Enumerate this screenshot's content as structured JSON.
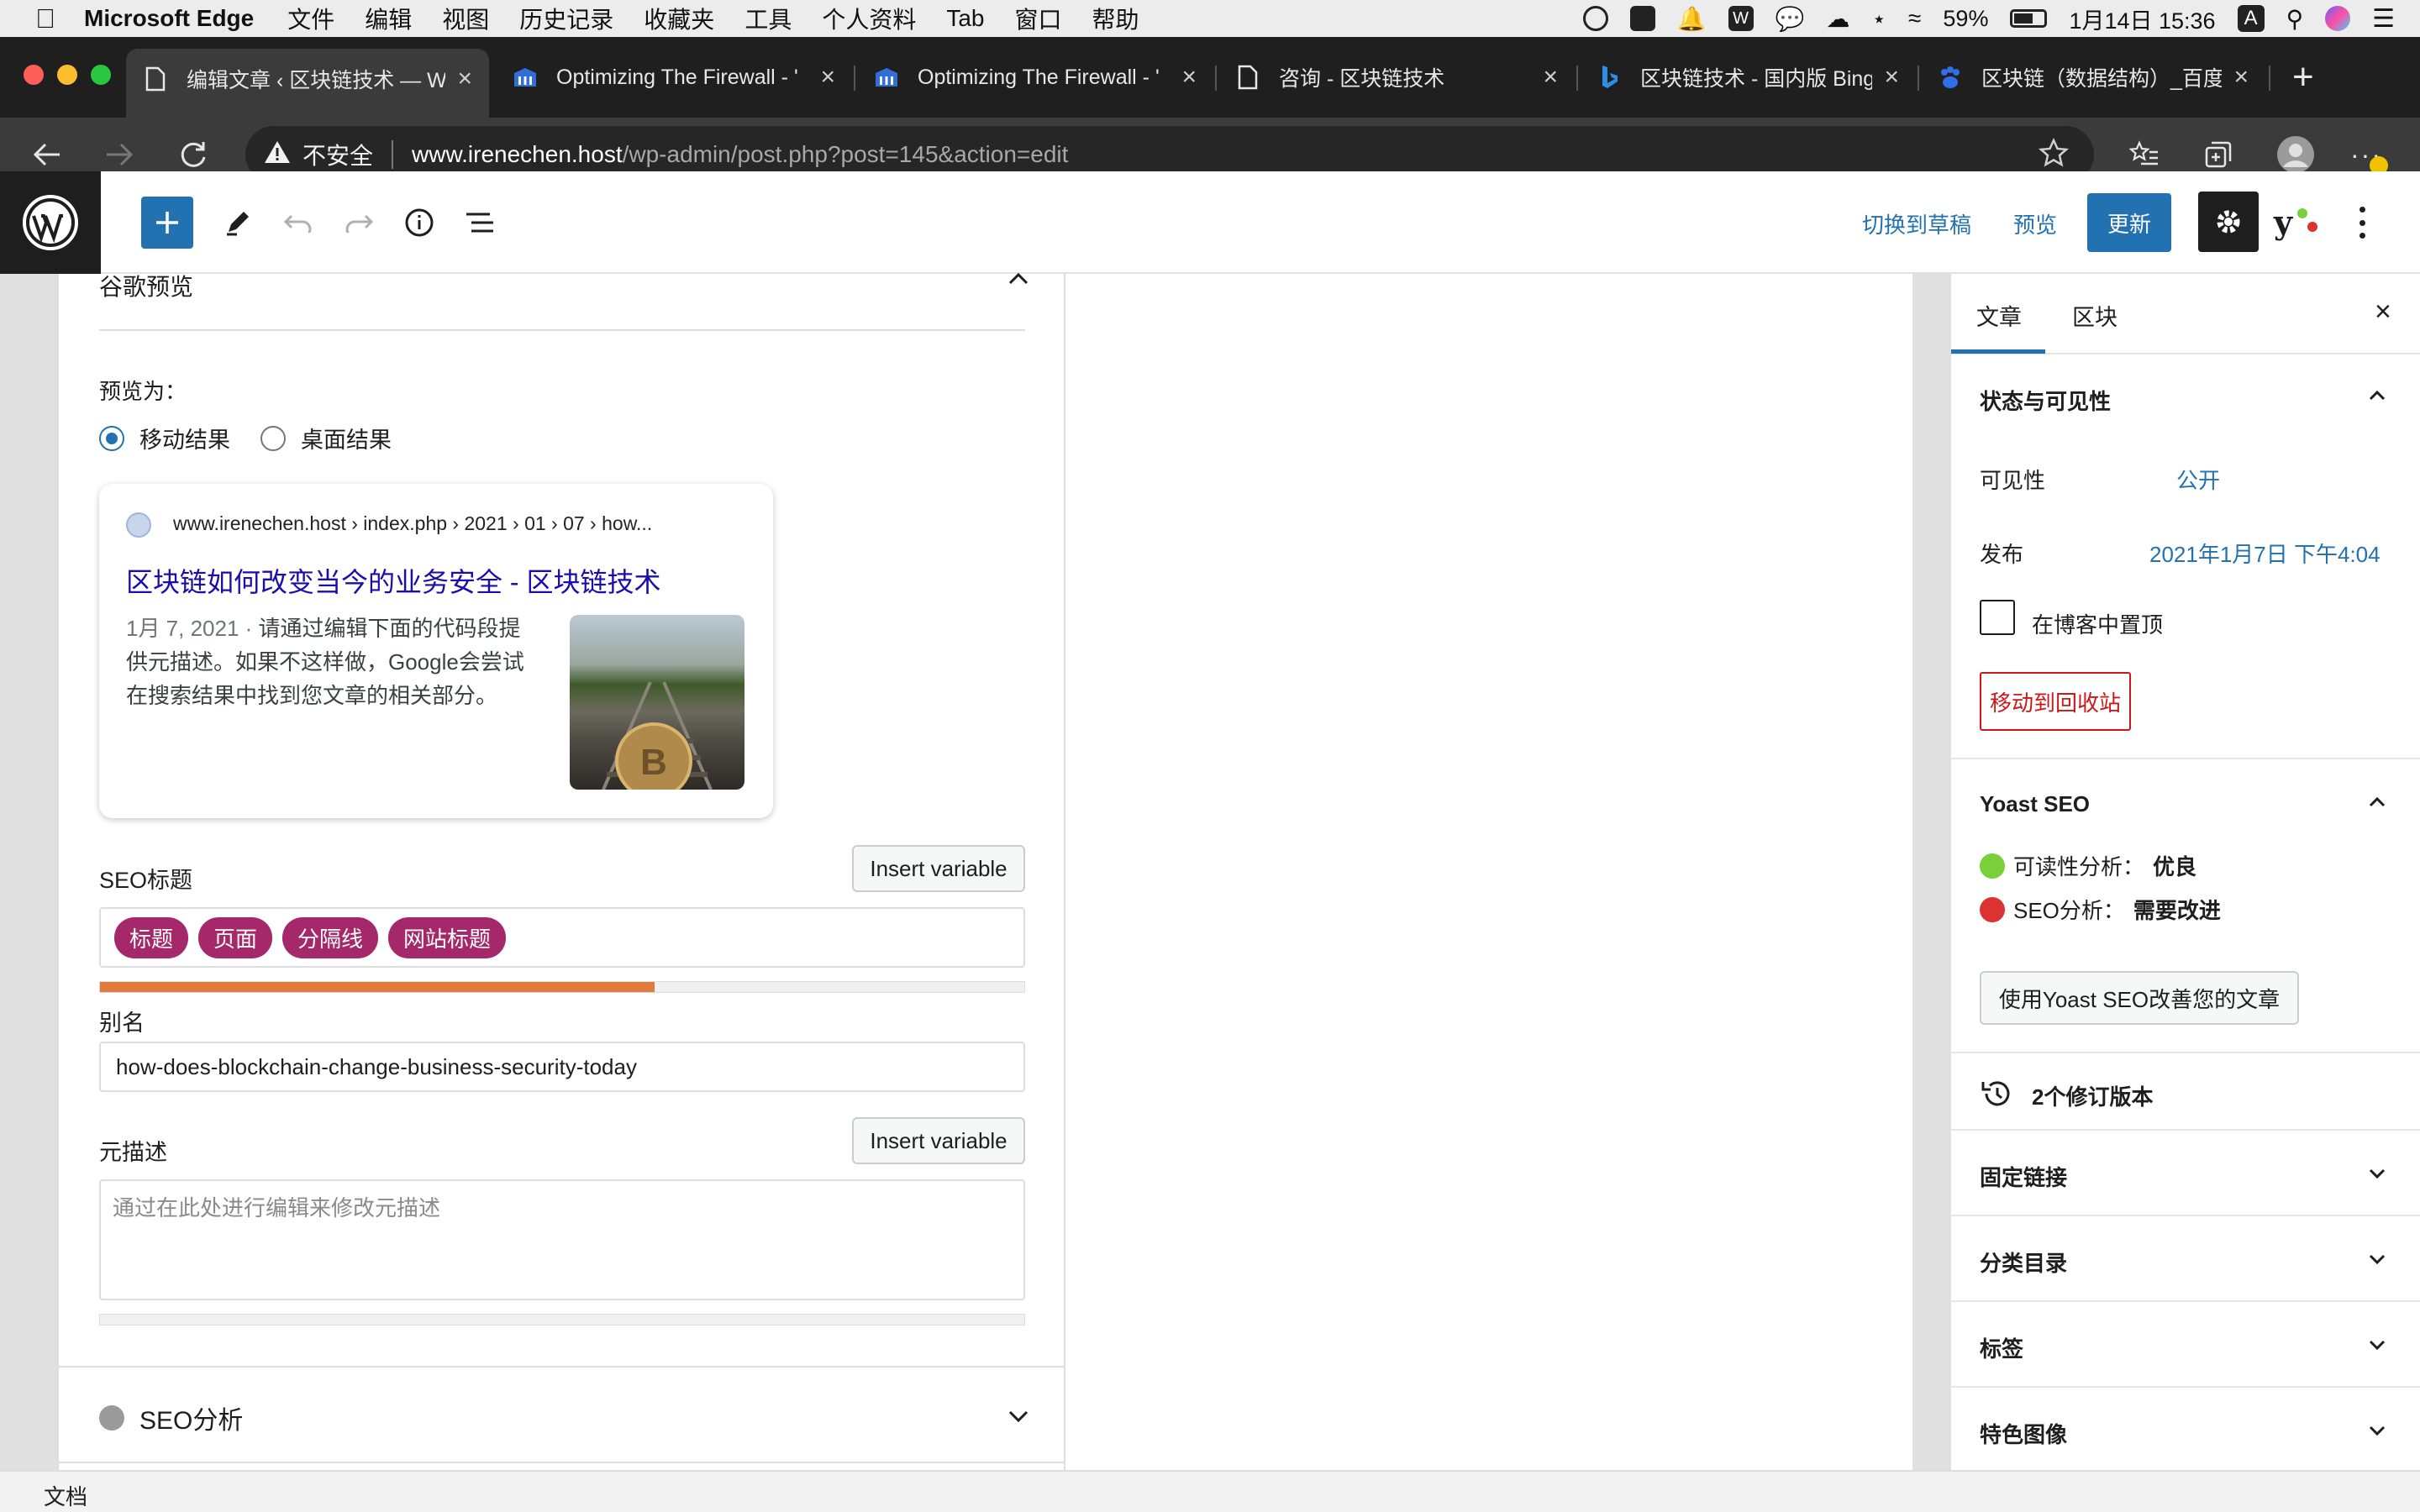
{
  "menubar": {
    "app": "Microsoft Edge",
    "items": [
      "文件",
      "编辑",
      "视图",
      "历史记录",
      "收藏夹",
      "工具",
      "个人资料",
      "Tab",
      "窗口",
      "帮助"
    ],
    "battery": "59%",
    "datetime": "1月14日 15:36",
    "input_method": "A"
  },
  "tabs": [
    {
      "label": "编辑文章 ‹ 区块链技术 — W",
      "active": true
    },
    {
      "label": "Optimizing The Firewall - '"
    },
    {
      "label": "Optimizing The Firewall - '"
    },
    {
      "label": "咨询 - 区块链技术"
    },
    {
      "label": "区块链技术 - 国内版 Bing"
    },
    {
      "label": "区块链（数据结构）_百度百"
    }
  ],
  "address": {
    "insecure_label": "不安全",
    "host": "www.irenechen.host",
    "path": "/wp-admin/post.php?post=145&action=edit"
  },
  "toolbar": {
    "switch_draft": "切换到草稿",
    "preview": "预览",
    "update": "更新"
  },
  "meta": {
    "google_preview_title": "谷歌预览",
    "preview_as": "预览为：",
    "mobile_result": "移动结果",
    "desktop_result": "桌面结果",
    "snippet_url": "www.irenechen.host › index.php › 2021 › 01 › 07 › how...",
    "snippet_title": "区块链如何改变当今的业务安全 - 区块链技术",
    "snippet_date": "1月 7, 2021 · ",
    "snippet_desc": "请通过编辑下面的代码段提供元描述。如果不这样做，Google会尝试在搜索结果中找到您文章的相关部分。",
    "seo_title_label": "SEO标题",
    "insert_variable": "Insert variable",
    "seo_title_pills": [
      "标题",
      "页面",
      "分隔线",
      "网站标题"
    ],
    "seo_title_progress": 0.6,
    "slug_label": "别名",
    "slug_value": "how-does-blockchain-change-business-security-today",
    "meta_desc_label": "元描述",
    "meta_desc_placeholder": "通过在此处进行编辑来修改元描述",
    "seo_analysis": "SEO分析"
  },
  "sidebar": {
    "tab_post": "文章",
    "tab_block": "区块",
    "status_title": "状态与可见性",
    "visibility_label": "可见性",
    "visibility_value": "公开",
    "publish_label": "发布",
    "publish_value": "2021年1月7日 下午4:04",
    "sticky_label": "在博客中置顶",
    "trash_button": "移动到回收站",
    "yoast_title": "Yoast SEO",
    "readability_label": "可读性分析：",
    "readability_value": "优良",
    "seo_label": "SEO分析：",
    "seo_value": "需要改进",
    "improve_button": "使用Yoast SEO改善您的文章",
    "revisions": "2个修订版本",
    "permalink": "固定链接",
    "categories": "分类目录",
    "tags": "标签",
    "featured_image": "特色图像"
  },
  "statusbar": {
    "breadcrumb": "文档"
  },
  "colors": {
    "wp_blue": "#2271b1",
    "pill_purple": "#a4286a",
    "progress_orange": "#e07b39",
    "trash_red": "#cc1818",
    "good_green": "#7ad03a",
    "bad_red": "#dc3232"
  }
}
